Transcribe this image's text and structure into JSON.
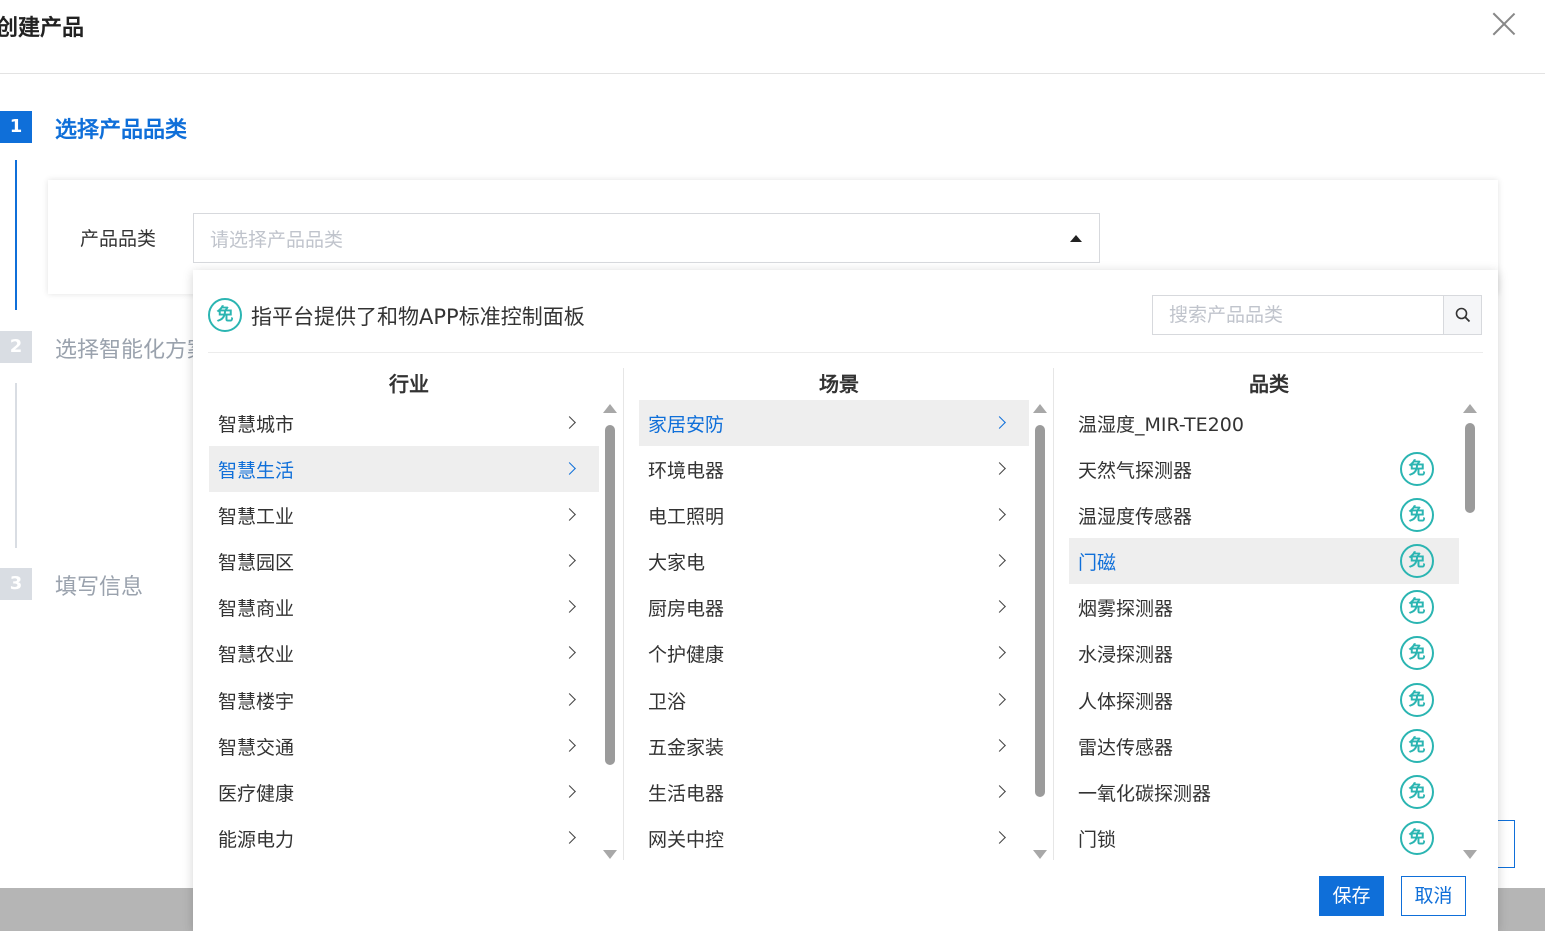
{
  "dialog": {
    "title": "创建产品"
  },
  "steps": [
    {
      "number": "1",
      "label": "选择产品品类"
    },
    {
      "number": "2",
      "label": "选择智能化方案"
    },
    {
      "number": "3",
      "label": "填写信息"
    }
  ],
  "form": {
    "category_label": "产品品类",
    "category_placeholder": "请选择产品品类"
  },
  "dropdown": {
    "badge_glyph": "免",
    "info_text": "指平台提供了和物APP标准控制面板",
    "search_placeholder": "搜索产品品类",
    "headers": {
      "industry": "行业",
      "scene": "场景",
      "category": "品类"
    },
    "industries": [
      "智慧城市",
      "智慧生活",
      "智慧工业",
      "智慧园区",
      "智慧商业",
      "智慧农业",
      "智慧楼宇",
      "智慧交通",
      "医疗健康",
      "能源电力"
    ],
    "selected_industry": "智慧生活",
    "scenes": [
      "家居安防",
      "环境电器",
      "电工照明",
      "大家电",
      "厨房电器",
      "个护健康",
      "卫浴",
      "五金家装",
      "生活电器",
      "网关中控"
    ],
    "selected_scene": "家居安防",
    "categories": [
      {
        "label": "温湿度_MIR-TE200",
        "badge": false
      },
      {
        "label": "天然气探测器",
        "badge": true
      },
      {
        "label": "温湿度传感器",
        "badge": true
      },
      {
        "label": "门磁",
        "badge": true
      },
      {
        "label": "烟雾探测器",
        "badge": true
      },
      {
        "label": "水浸探测器",
        "badge": true
      },
      {
        "label": "人体探测器",
        "badge": true
      },
      {
        "label": "雷达传感器",
        "badge": true
      },
      {
        "label": "一氧化碳探测器",
        "badge": true
      },
      {
        "label": "门锁",
        "badge": true
      }
    ],
    "selected_category": "门磁",
    "save_label": "保存",
    "cancel_label": "取消"
  },
  "colors": {
    "primary": "#0f6fd9",
    "badge": "#2bb5b2",
    "inactive_step": "#d9dde3"
  }
}
